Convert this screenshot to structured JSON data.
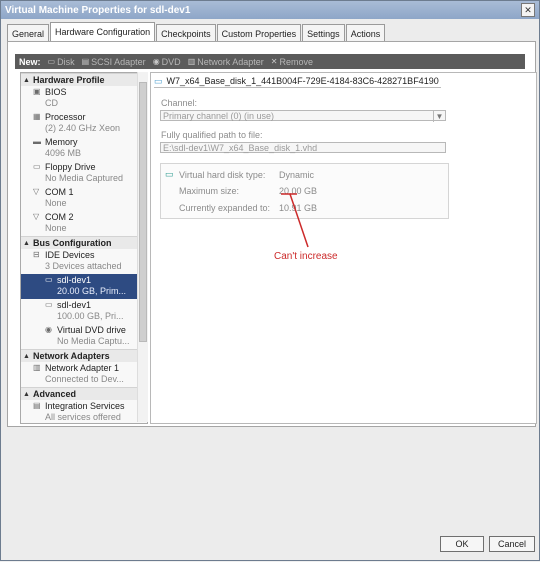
{
  "window": {
    "title": "Virtual Machine Properties for sdl-dev1"
  },
  "tabs": [
    "General",
    "Hardware Configuration",
    "Checkpoints",
    "Custom Properties",
    "Settings",
    "Actions"
  ],
  "toolbar": {
    "label": "New:",
    "items": [
      {
        "label": "Disk",
        "icon": "disk-icon"
      },
      {
        "label": "SCSI Adapter",
        "icon": "scsi-icon"
      },
      {
        "label": "DVD",
        "icon": "dvd-icon"
      },
      {
        "label": "Network Adapter",
        "icon": "network-icon"
      },
      {
        "label": "Remove",
        "icon": "remove-icon"
      }
    ]
  },
  "nav": {
    "sections": [
      {
        "title": "Hardware Profile",
        "items": [
          {
            "label": "BIOS",
            "sub": "CD",
            "icon": "bios-icon"
          },
          {
            "label": "Processor",
            "sub": "(2) 2.40 GHz Xeon",
            "icon": "processor-icon"
          },
          {
            "label": "Memory",
            "sub": "4096 MB",
            "icon": "memory-icon"
          },
          {
            "label": "Floppy Drive",
            "sub": "No Media Captured",
            "icon": "floppy-icon"
          },
          {
            "label": "COM 1",
            "sub": "None",
            "icon": "com-icon"
          },
          {
            "label": "COM 2",
            "sub": "None",
            "icon": "com-icon"
          }
        ]
      },
      {
        "title": "Bus Configuration",
        "items": [
          {
            "label": "IDE Devices",
            "sub": "3 Devices attached",
            "icon": "ide-icon"
          },
          {
            "label": "sdl-dev1",
            "sub": "20.00 GB, Prim...",
            "icon": "disk-icon",
            "child": true,
            "selected": true
          },
          {
            "label": "sdl-dev1",
            "sub": "100.00 GB, Pri...",
            "icon": "disk-icon",
            "child": true
          },
          {
            "label": "Virtual DVD drive",
            "sub": "No Media Captu...",
            "icon": "dvd-icon",
            "child": true
          }
        ]
      },
      {
        "title": "Network Adapters",
        "items": [
          {
            "label": "Network Adapter 1",
            "sub": "Connected to Dev...",
            "icon": "network-icon"
          }
        ]
      },
      {
        "title": "Advanced",
        "items": [
          {
            "label": "Integration Services",
            "sub": "All services offered",
            "icon": "integration-icon"
          }
        ]
      }
    ]
  },
  "detail": {
    "header_path": "W7_x64_Base_disk_1_441B004F-729E-4184-83C6-428271BF4190",
    "channel_label": "Channel:",
    "channel_value": "Primary channel (0) (in use)",
    "path_label": "Fully qualified path to file:",
    "path_value": "E:\\sdl-dev1\\W7_x64_Base_disk_1.vhd",
    "info": [
      {
        "key": "Virtual hard disk type:",
        "value": "Dynamic"
      },
      {
        "key": "Maximum size:",
        "value": "20.00 GB"
      },
      {
        "key": "Currently expanded to:",
        "value": "10.91 GB"
      }
    ],
    "annotation": "Can't increase",
    "annotation_color": "#cc2a2a"
  },
  "buttons": {
    "ok": "OK",
    "cancel": "Cancel"
  }
}
